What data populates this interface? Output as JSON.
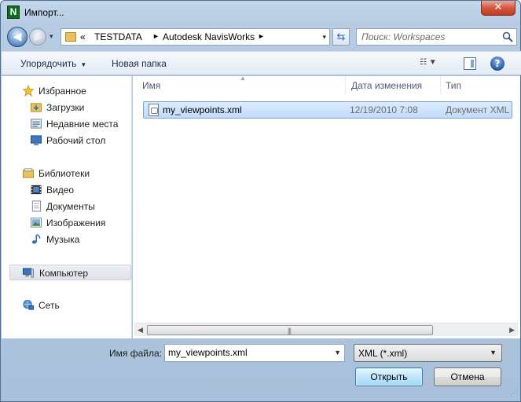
{
  "window": {
    "title": "Импорт...",
    "close_glyph": "✕",
    "app_icon_letter": "N",
    "icon": "navisworks-app-icon"
  },
  "nav_buttons": {
    "back": "◀",
    "forward": "▶",
    "history": "▾"
  },
  "address": {
    "prefix": "«",
    "crumbs": [
      "TESTDATA",
      "Autodesk NavisWorks"
    ],
    "separator": "►",
    "dropdown": "▾"
  },
  "refresh": {
    "glyph": "⇆"
  },
  "search": {
    "placeholder": "Поиск: Workspaces",
    "value": ""
  },
  "toolbar": {
    "organize_label": "Упорядочить",
    "organize_arrow": "▼",
    "new_folder_label": "Новая папка",
    "view_glyph": "☷ ▼",
    "help_glyph": "?"
  },
  "sidebar": {
    "favorites": {
      "label": "Избранное",
      "icon": "star-icon",
      "items": [
        {
          "label": "Загрузки",
          "icon": "downloads-folder-icon"
        },
        {
          "label": "Недавние места",
          "icon": "recent-places-icon"
        },
        {
          "label": "Рабочий стол",
          "icon": "desktop-icon"
        }
      ]
    },
    "libraries": {
      "label": "Библиотеки",
      "icon": "libraries-icon",
      "items": [
        {
          "label": "Видео",
          "icon": "video-icon"
        },
        {
          "label": "Документы",
          "icon": "documents-icon"
        },
        {
          "label": "Изображения",
          "icon": "pictures-icon"
        },
        {
          "label": "Музыка",
          "icon": "music-icon"
        }
      ]
    },
    "computer": {
      "label": "Компьютер",
      "icon": "computer-icon"
    },
    "network": {
      "label": "Сеть",
      "icon": "network-icon"
    }
  },
  "file_list": {
    "columns": [
      "Имя",
      "Дата изменения",
      "Тип"
    ],
    "sort_caret": "▲",
    "rows": [
      {
        "name": "my_viewpoints.xml",
        "date": "12/19/2010 7:08",
        "type": "Документ XML",
        "icon": "xml-file-icon",
        "selected": true
      }
    ]
  },
  "scrollbar": {
    "left": "◀",
    "right": "▶",
    "grip": "|||"
  },
  "footer": {
    "filename_label": "Имя файла:",
    "filename_value": "my_viewpoints.xml",
    "filename_dropdown": "▼",
    "filetype_value": "XML (*.xml)",
    "filetype_dropdown": "▼",
    "open_label": "Открыть",
    "cancel_label": "Отмена",
    "resize_glyph": "⋰"
  },
  "colors": {
    "frame": "#b7cce3",
    "selection": "#c1dcfc",
    "accent": "#3c7fb1"
  }
}
